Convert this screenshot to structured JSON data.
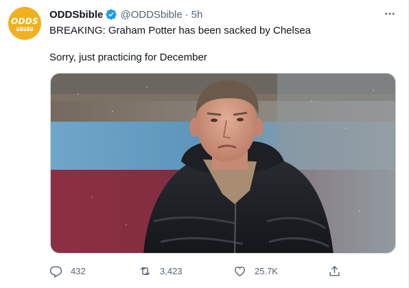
{
  "author": {
    "display_name": "ODDSbible",
    "handle": "@ODDSbible",
    "separator": "·",
    "time": "5h",
    "avatar_text_top": "ODDS",
    "avatar_text_bottom": [
      "B",
      "I",
      "B",
      "L",
      "E"
    ],
    "avatar_color": "#f2b01e",
    "verified": true,
    "verified_color": "#1d9bf0"
  },
  "tweet": {
    "line1": "BREAKING: Graham Potter has been sacked by Chelsea",
    "line2": "Sorry, just practicing for December"
  },
  "media": {
    "kind": "photo"
  },
  "actions": {
    "reply_count": "432",
    "retweet_count": "3,423",
    "like_count": "25.7K"
  },
  "icons": {
    "reply": "reply-icon",
    "retweet": "retweet-icon",
    "like": "like-icon",
    "share": "share-icon",
    "more": "more-options-icon"
  },
  "colors": {
    "text": "#0f1419",
    "muted": "#536471"
  }
}
